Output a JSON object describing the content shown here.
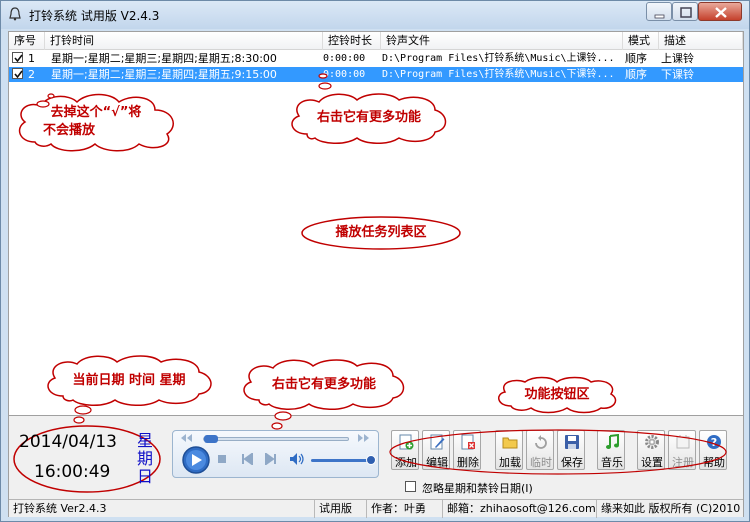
{
  "window": {
    "title": "打铃系统 试用版 V2.4.3"
  },
  "list": {
    "columns": [
      "序号",
      "打铃时间",
      "控铃时长",
      "铃声文件",
      "模式",
      "描述"
    ],
    "rows": [
      {
        "checked": true,
        "no": "1",
        "time": "星期一;星期二;星期三;星期四;星期五;8:30:00",
        "duration": "0:00:00",
        "file": "D:\\Program Files\\打铃系统\\Music\\上课铃...",
        "mode": "顺序",
        "desc": "上课铃",
        "selected": false
      },
      {
        "checked": true,
        "no": "2",
        "time": "星期一;星期二;星期三;星期四;星期五;9:15:00",
        "duration": "0:00:00",
        "file": "D:\\Program Files\\打铃系统\\Music\\下课铃...",
        "mode": "顺序",
        "desc": "下课铃",
        "selected": true
      }
    ]
  },
  "annotations": {
    "uncheck_line1": "去掉这个“√”将",
    "uncheck_line2": "不会播放",
    "right_click_list": "右击它有更多功能",
    "task_area": "播放任务列表区",
    "date_time": "当前日期 时间 星期",
    "right_click_player": "右击它有更多功能",
    "buttons_area": "功能按钮区"
  },
  "clock": {
    "date": "2014/04/13",
    "time": "16:00:49",
    "weekday": "星期日"
  },
  "toolbar": {
    "add": "添加",
    "edit": "编辑",
    "delete": "删除",
    "load": "加载",
    "temp": "临时",
    "save": "保存",
    "music": "音乐",
    "settings": "设置",
    "register": "注册",
    "help": "帮助"
  },
  "options": {
    "ignore_label": "忽略星期和禁铃日期(I)",
    "ignore_checked": false
  },
  "statusbar": {
    "version": "打铃系统 Ver2.4.3",
    "edition": "试用版",
    "author": "作者：叶勇",
    "email": "邮箱：zhihaosoft@126.com",
    "copyright": "缘来如此 版权所有 (C)2010"
  },
  "colors": {
    "selection": "#3399ff",
    "annotation_text": "#c00000",
    "cloud_stroke": "#c00000",
    "weekday_text": "#1010c8"
  }
}
